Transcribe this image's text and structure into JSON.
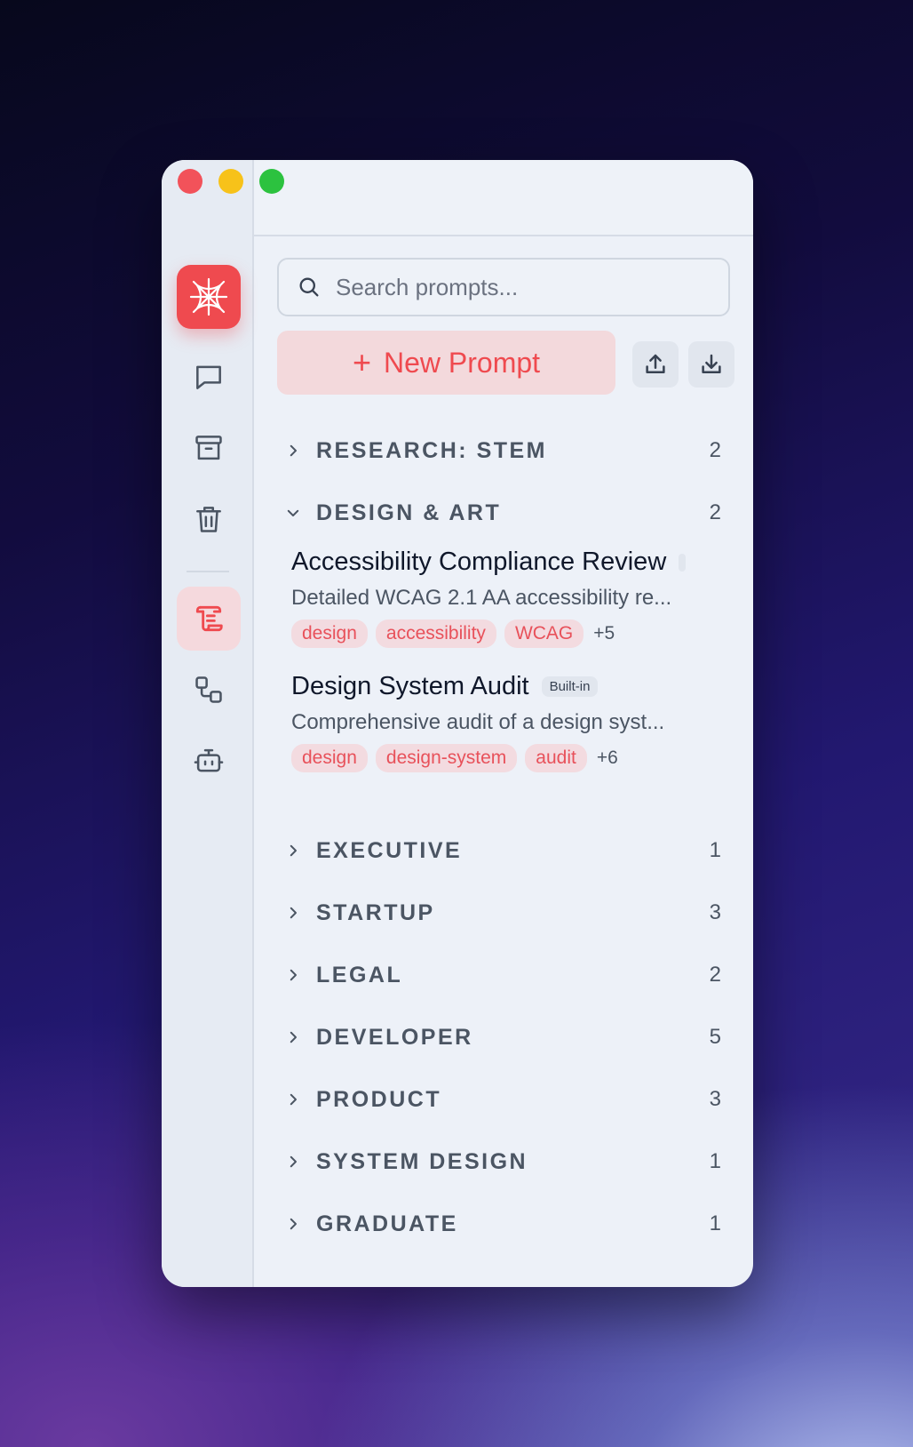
{
  "search": {
    "placeholder": "Search prompts..."
  },
  "toolbar": {
    "new_prompt_label": "New Prompt",
    "new_prompt_plus": "+"
  },
  "categories_top": [
    {
      "name": "RESEARCH: STEM",
      "count": "2",
      "expanded": false
    },
    {
      "name": "DESIGN & ART",
      "count": "2",
      "expanded": true
    }
  ],
  "prompts": [
    {
      "title": "Accessibility Compliance Review",
      "badge": "",
      "description": "Detailed WCAG 2.1 AA accessibility re...",
      "tags": [
        "design",
        "accessibility",
        "WCAG"
      ],
      "more": "+5"
    },
    {
      "title": "Design System Audit",
      "badge": "Built-in",
      "description": "Comprehensive audit of a design syst...",
      "tags": [
        "design",
        "design-system",
        "audit"
      ],
      "more": "+6"
    }
  ],
  "categories_bottom": [
    {
      "name": "EXECUTIVE",
      "count": "1"
    },
    {
      "name": "STARTUP",
      "count": "3"
    },
    {
      "name": "LEGAL",
      "count": "2"
    },
    {
      "name": "DEVELOPER",
      "count": "5"
    },
    {
      "name": "PRODUCT",
      "count": "3"
    },
    {
      "name": "SYSTEM DESIGN",
      "count": "1"
    },
    {
      "name": "GRADUATE",
      "count": "1"
    }
  ],
  "colors": {
    "accent": "#ef4a4f",
    "tag_bg": "#f3dbe0",
    "text_muted": "#4b5563"
  },
  "icons": {
    "rail": [
      "app-logo-icon",
      "chat-icon",
      "archive-icon",
      "trash-icon",
      "scroll-icon",
      "workflow-icon",
      "bot-icon"
    ]
  }
}
